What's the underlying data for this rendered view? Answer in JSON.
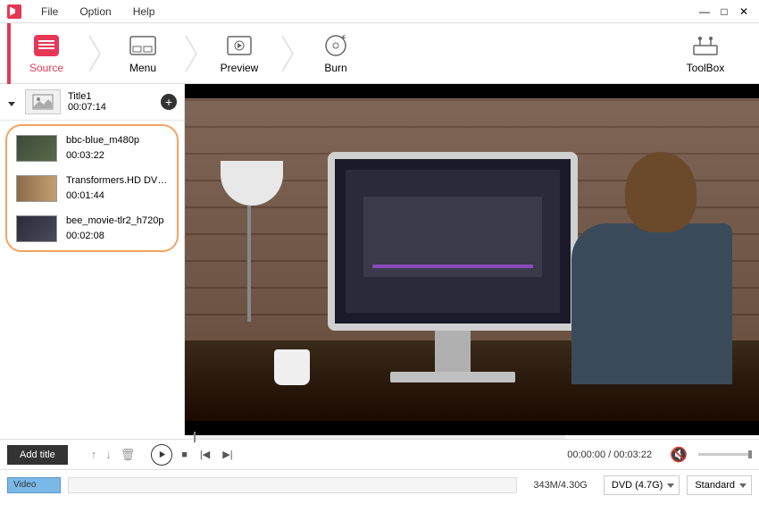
{
  "menubar": {
    "file": "File",
    "option": "Option",
    "help": "Help"
  },
  "toolbar": {
    "source": "Source",
    "menu": "Menu",
    "preview": "Preview",
    "burn": "Burn",
    "toolbox": "ToolBox"
  },
  "title_group": {
    "name": "Title1",
    "duration": "00:07:14"
  },
  "clips": [
    {
      "name": "bbc-blue_m480p",
      "duration": "00:03:22"
    },
    {
      "name": "Transformers.HD DVD...",
      "duration": "00:01:44"
    },
    {
      "name": "bee_movie-tlr2_h720p",
      "duration": "00:02:08"
    }
  ],
  "controls": {
    "add_title": "Add title",
    "time_current": "00:00:00",
    "time_total": "00:03:22"
  },
  "bottom": {
    "video_label": "Video",
    "size": "343M/4.30G",
    "disc_type": "DVD (4.7G)",
    "quality": "Standard"
  }
}
